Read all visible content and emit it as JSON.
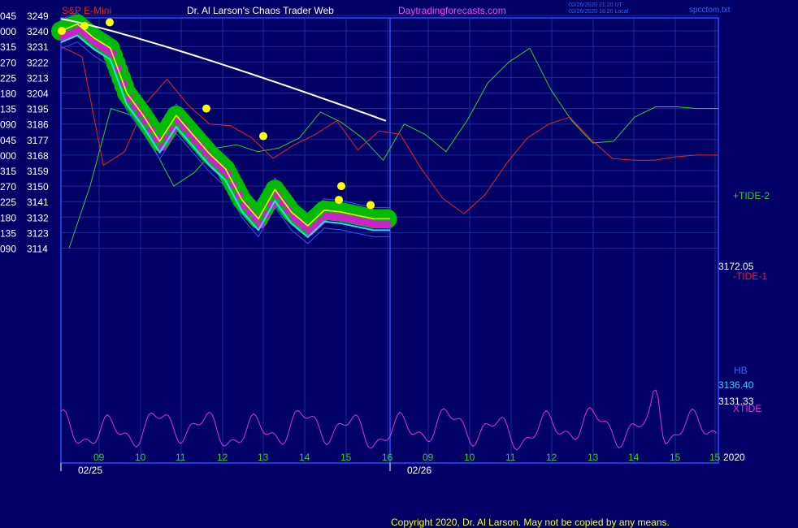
{
  "header": {
    "symbol": "S&P E-Mini",
    "title": "Dr. Al Larson's Chaos Trader Web",
    "site": "Daytradingforecasts.com",
    "stamp_line1": "02/26/2020 21:20 UT",
    "stamp_line2": "02/26/2020 16:20 Local",
    "file": "spcctom.txt"
  },
  "footer": {
    "copyright": "Copyright 2020, Dr. Al Larson. May not be copied by any means."
  },
  "colors": {
    "background": "#000066",
    "grid": "#1a2d9a",
    "frame": "#2a4cff",
    "price_band": "#00bb00",
    "price_line": "#ffff00",
    "close_dots": "#cc22cc",
    "white_ma": "#ffffff",
    "cyan_ma": "#22ddff",
    "blue_bands": "#3355ff",
    "tide_plus": "#33cc33",
    "tide_minus": "#ee2222",
    "xtide": "#dd33dd",
    "swing_dots": "#ffff00"
  },
  "chart_data": {
    "type": "line",
    "y_ticks": [
      {
        "angle": "045",
        "price": "3249"
      },
      {
        "angle": "000",
        "price": "3240"
      },
      {
        "angle": "315",
        "price": "3231"
      },
      {
        "angle": "270",
        "price": "3222"
      },
      {
        "angle": "225",
        "price": "3213"
      },
      {
        "angle": "180",
        "price": "3204"
      },
      {
        "angle": "135",
        "price": "3195"
      },
      {
        "angle": "090",
        "price": "3186"
      },
      {
        "angle": "045",
        "price": "3177"
      },
      {
        "angle": "000",
        "price": "3168"
      },
      {
        "angle": "315",
        "price": "3159"
      },
      {
        "angle": "270",
        "price": "3150"
      },
      {
        "angle": "225",
        "price": "3141"
      },
      {
        "angle": "180",
        "price": "3132"
      },
      {
        "angle": "135",
        "price": "3123"
      },
      {
        "angle": "090",
        "price": "3114"
      }
    ],
    "ylim": [
      3114,
      3249
    ],
    "hour_ticks": [
      "09",
      "10",
      "11",
      "12",
      "13",
      "14",
      "15",
      "16",
      "09",
      "10",
      "11",
      "12",
      "13",
      "14",
      "15",
      "15"
    ],
    "date_labels": [
      "02/25",
      "02/26"
    ],
    "year_label": "2020",
    "series": [
      {
        "name": "+TIDE-2",
        "labels_right": [
          "+TIDE-2"
        ],
        "x": [
          0,
          1,
          2,
          3,
          4,
          5,
          6,
          7,
          8,
          9,
          10,
          11,
          12,
          13,
          14,
          15,
          16,
          17,
          18,
          19,
          20,
          21,
          22,
          23,
          24,
          25,
          26,
          27,
          28,
          29,
          30,
          31
        ],
        "values": [
          3114,
          3150,
          3195,
          3191,
          3173,
          3150,
          3158,
          3172,
          3174,
          3170,
          3172,
          3178,
          3193,
          3187,
          3178,
          3165,
          3186,
          3180,
          3170,
          3188,
          3210,
          3222,
          3230,
          3206,
          3188,
          3175,
          3176,
          3190,
          3196,
          3196,
          3195,
          3195
        ]
      },
      {
        "name": "-TIDE-1",
        "labels_right": [
          "3172.05",
          "-TIDE-1"
        ],
        "x": [
          0,
          1,
          2,
          3,
          4,
          5,
          6,
          7,
          8,
          9,
          10,
          11,
          12,
          13,
          14,
          15,
          16,
          17,
          18,
          19,
          20,
          21,
          22,
          23,
          24,
          25,
          26,
          27,
          28,
          29,
          30,
          31
        ],
        "values": [
          3231,
          3225,
          3162,
          3170,
          3198,
          3212,
          3197,
          3186,
          3185,
          3178,
          3166,
          3174,
          3180,
          3188,
          3171,
          3182,
          3180,
          3160,
          3143,
          3134,
          3145,
          3163,
          3178,
          3186,
          3190,
          3177,
          3166,
          3165,
          3165,
          3167,
          3168,
          3168
        ]
      },
      {
        "name": "HB",
        "labels_right": [
          "HB",
          "3136.40"
        ]
      },
      {
        "name": "Price",
        "labels_right": [
          "3131.33"
        ],
        "x": [
          0,
          1,
          2,
          3,
          4,
          5,
          6,
          7,
          8,
          9,
          10,
          11,
          12,
          13,
          14,
          15,
          16,
          17,
          18,
          19,
          20
        ],
        "values": [
          3240,
          3244,
          3236,
          3230,
          3204,
          3191,
          3176,
          3191,
          3180,
          3169,
          3160,
          3142,
          3131,
          3148,
          3135,
          3127,
          3136,
          3135,
          3133,
          3131,
          3131
        ]
      },
      {
        "name": "XTIDE",
        "labels_right": [
          "XTIDE"
        ]
      }
    ]
  }
}
